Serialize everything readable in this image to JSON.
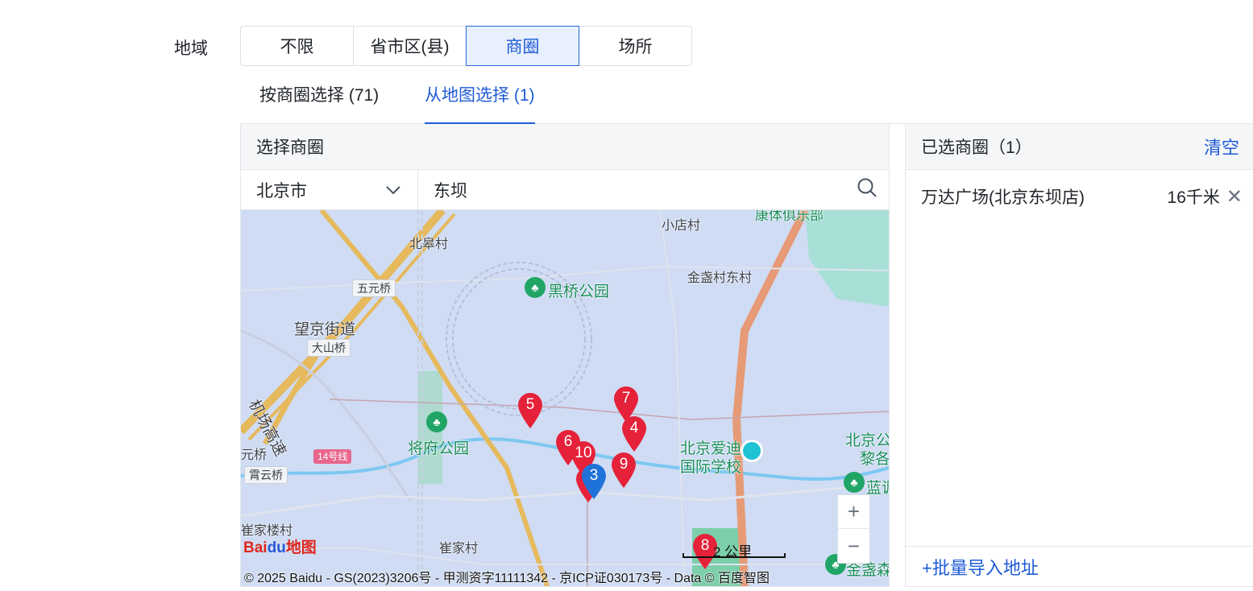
{
  "region": {
    "label": "地域",
    "segments": [
      "不限",
      "省市区(县)",
      "商圈",
      "场所"
    ],
    "active_segment": "商圈"
  },
  "tabs": [
    {
      "label": "按商圈选择 (71)",
      "active": false
    },
    {
      "label": "从地图选择 (1)",
      "active": true
    }
  ],
  "left_panel": {
    "title": "选择商圈",
    "city_select": "北京市",
    "search_value": "东坝",
    "search_placeholder": ""
  },
  "map": {
    "places": {
      "beigaocun": "北皋村",
      "xiaodiancun": "小店村",
      "kangti": "康体俱乐部",
      "wuyuanqiao": "五元桥",
      "heiqiao": "黑桥公园",
      "jinzhan_east": "金盏村东村",
      "wangjing": "望京街道",
      "dashanqiao": "大山桥",
      "jichang": "机场高速",
      "jiangfu": "将府公园",
      "aidi1": "北京爱迪",
      "aidi2": "国际学校",
      "beijinggong": "北京公",
      "lige": "黎各",
      "yuanqiao": "元桥",
      "line14": "14号线",
      "xiayunqiao": "霄云桥",
      "lan": "蓝调",
      "cuijialou": "崔家楼村",
      "cuijiacun": "崔家村",
      "jinzhansen": "金盏森"
    },
    "markers": [
      "5",
      "7",
      "4",
      "6",
      "10",
      "9",
      "3",
      "8"
    ],
    "zoom_in": "+",
    "zoom_out": "−",
    "scale_label": "2 公里",
    "logo_text": "Bai",
    "logo_paw": "du",
    "logo_suffix": "地图",
    "copyright": "© 2025 Baidu - GS(2023)3206号 - 甲测资字11111342 - 京ICP证030173号 - Data © 百度智图"
  },
  "right_panel": {
    "title": "已选商圈（1）",
    "clear_label": "清空",
    "items": [
      {
        "name": "万达广场(北京东坝店)",
        "distance": "16千米"
      }
    ],
    "import_label": "+批量导入地址"
  },
  "colors": {
    "accent": "#1f5bd6",
    "marker_red": "#e5223a",
    "marker_blue": "#1f72d8",
    "map_bg": "#cfdcf4"
  }
}
